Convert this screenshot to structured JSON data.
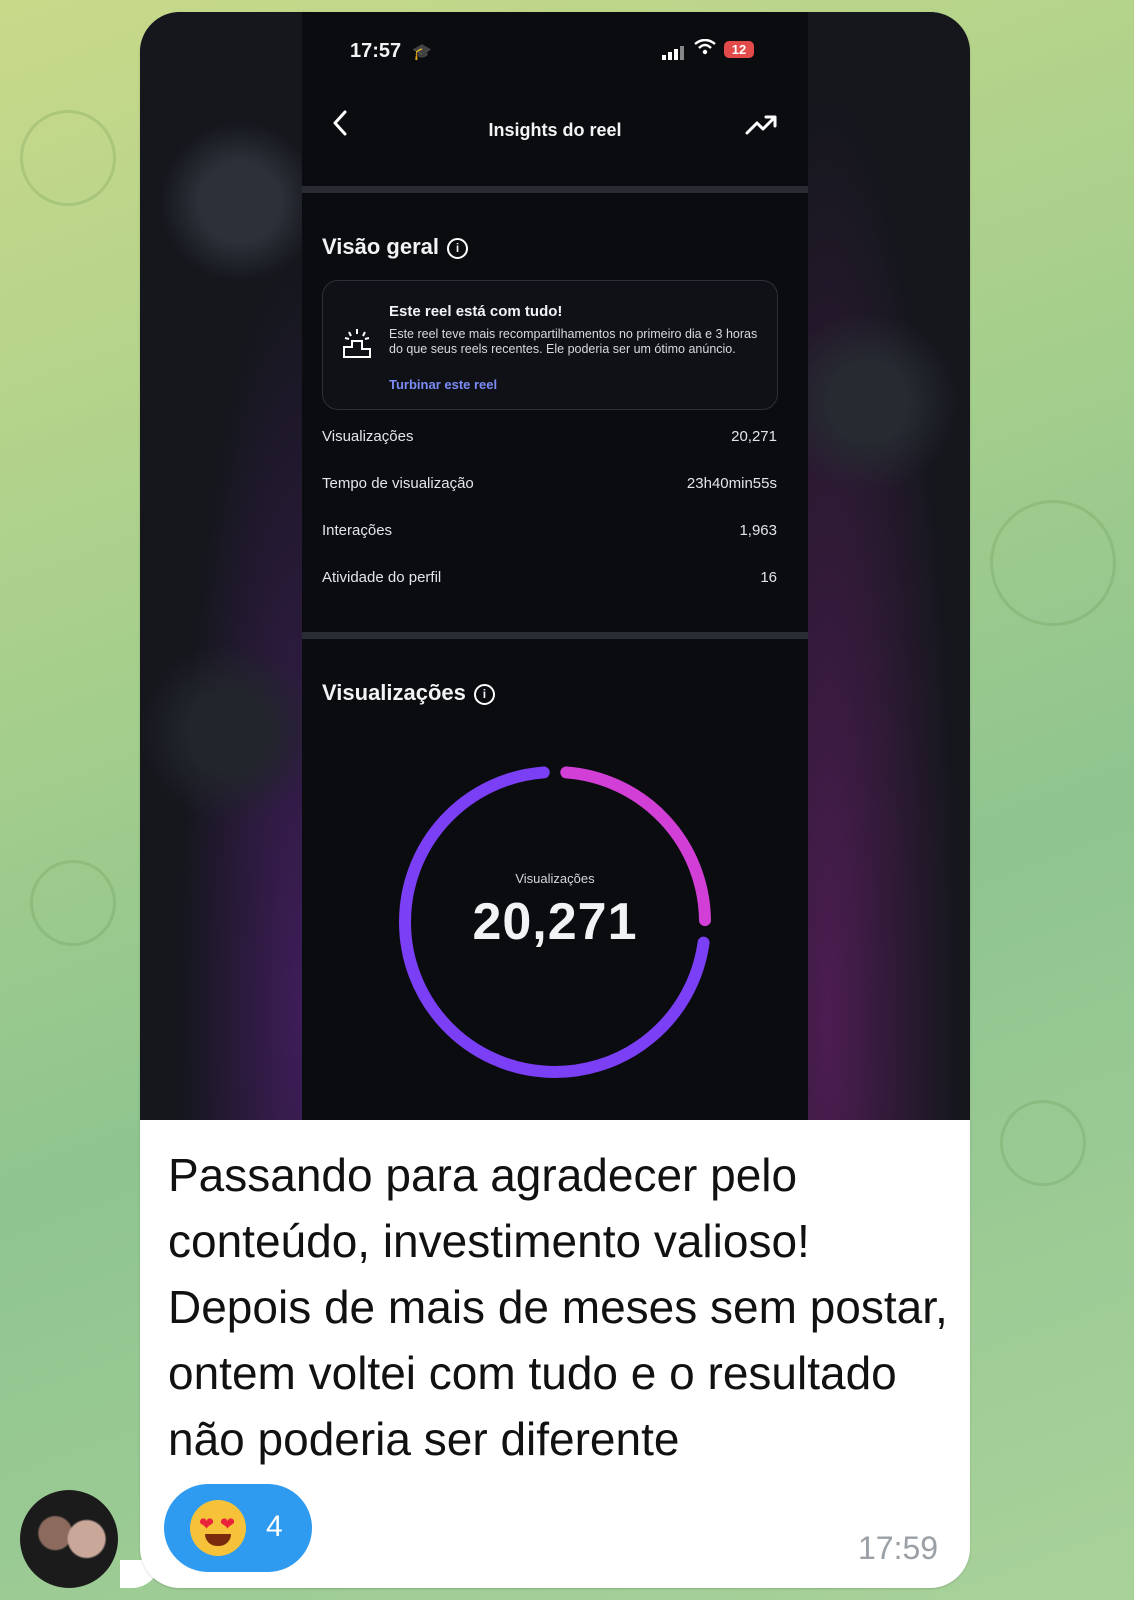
{
  "status_bar": {
    "time": "17:57",
    "battery": "12"
  },
  "header": {
    "title": "Insights do reel"
  },
  "overview": {
    "title": "Visão geral",
    "card_title": "Este reel está com tudo!",
    "card_body": "Este reel teve mais recompartilhamentos no primeiro dia e 3 horas do que seus reels recentes. Ele poderia ser um ótimo anúncio.",
    "card_link": "Turbinar este reel",
    "rows": [
      {
        "label": "Visualizações",
        "value": "20,271"
      },
      {
        "label": "Tempo de visualização",
        "value": "23h40min55s"
      },
      {
        "label": "Interações",
        "value": "1,963"
      },
      {
        "label": "Atividade do perfil",
        "value": "16"
      }
    ]
  },
  "views": {
    "title": "Visualizações",
    "donut_label": "Visualizações",
    "donut_value": "20,271",
    "segments": [
      {
        "share": 0.26,
        "color": "#d13fd6"
      },
      {
        "share": 0.74,
        "color": "#7b3ff6"
      }
    ]
  },
  "message": {
    "text": "Passando para agradecer pelo conteúdo, investimento valioso! Depois de mais de meses sem postar, ontem voltei com tudo e o resultado não poderia ser diferente",
    "time": "17:59",
    "reaction": {
      "emoji": "heart-eyes",
      "count": "4"
    }
  },
  "colors": {
    "reaction_bg": "#2f9bf0",
    "link": "#7b8cf6"
  }
}
